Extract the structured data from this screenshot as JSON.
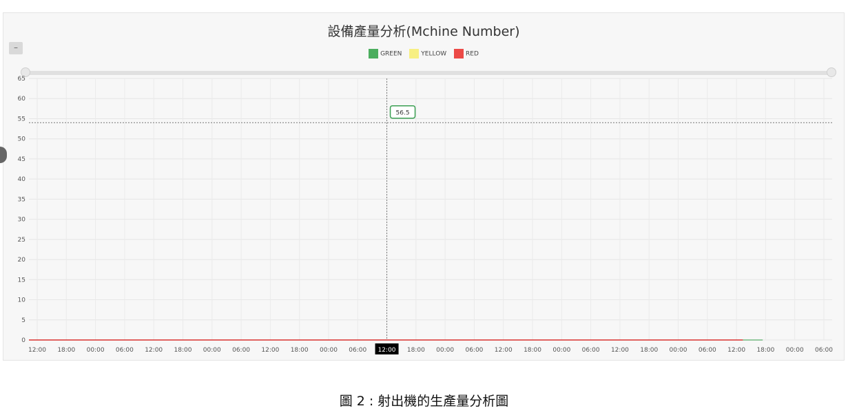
{
  "caption": "圖 2 : 射出機的生產量分析圖",
  "toolbar": {
    "zoom_out_label": "–"
  },
  "chart_data": {
    "type": "area",
    "stacked": true,
    "title": "設備產量分析(Mchine Number)",
    "xlabel": "",
    "ylabel": "",
    "ylim": [
      0,
      65
    ],
    "yticks": [
      0,
      5,
      10,
      15,
      20,
      25,
      30,
      35,
      40,
      45,
      50,
      55,
      60,
      65
    ],
    "x_tick_labels": [
      "12:00",
      "18:00",
      "00:00",
      "06:00",
      "12:00",
      "18:00",
      "00:00",
      "06:00",
      "12:00",
      "18:00",
      "00:00",
      "06:00",
      "12:00",
      "18:00",
      "00:00",
      "06:00",
      "12:00",
      "18:00",
      "00:00",
      "06:00",
      "12:00",
      "18:00",
      "00:00",
      "06:00",
      "12:00",
      "18:00",
      "00:00",
      "06:00"
    ],
    "x_highlight": "12:00",
    "grid": true,
    "legend_position": "top-center",
    "reference_line_y": 54,
    "tooltip_value": "56.5",
    "colors": {
      "GREEN": "#4cae5f",
      "YELLOW": "#f7ef83",
      "RED": "#ec4a47"
    },
    "x": [
      0,
      1,
      2,
      3,
      3.3,
      3.6,
      4,
      4.3,
      4.6,
      5,
      5.5,
      6,
      6.3,
      6.6,
      7,
      7.5,
      8,
      8.3,
      8.6,
      9,
      9.3,
      9.6,
      10,
      10.3,
      10.6,
      11,
      11.3,
      11.6,
      12,
      12.3,
      12.6,
      13,
      13.3,
      13.6,
      14,
      14.3,
      14.6,
      15,
      15.3,
      15.6,
      16,
      16.3,
      16.6,
      17,
      17.5,
      18,
      18.3,
      18.6,
      19,
      19.3,
      19.6,
      20,
      20.3,
      20.6,
      21,
      21.3,
      21.6,
      22,
      22.5,
      23,
      23.5,
      24,
      24.5,
      25,
      25.5,
      26,
      26.3,
      26.6,
      27,
      27.3,
      27.6,
      28,
      28.3,
      28.6,
      29,
      29.5,
      30,
      30.5,
      31,
      31.5,
      32,
      32.5,
      33,
      33.5,
      34,
      34.5,
      35,
      35.5,
      36,
      36.5,
      37,
      37.5,
      38,
      38.5,
      39,
      39.5,
      40,
      40.5,
      41,
      41.5,
      42,
      42.5,
      43,
      43.5,
      44,
      44.5,
      45,
      45.5,
      46,
      46.5,
      47,
      47.5,
      48,
      48.5,
      49,
      49.5,
      50,
      50.5,
      51,
      51.5,
      52,
      52.5,
      53,
      53.5,
      54,
      54.5,
      55,
      55.5,
      56,
      56.5,
      57,
      57.5,
      58,
      58.5,
      59,
      59.5,
      60,
      60.5,
      61,
      61.5,
      62,
      62.5,
      63,
      63.5,
      64,
      64.5,
      65,
      65.5,
      66,
      66.5,
      67,
      67.5,
      68,
      68.5,
      69,
      69.5,
      70,
      70.5,
      71,
      71.5,
      72,
      72.5,
      73,
      73.5,
      74,
      74.5,
      75,
      75.5,
      76,
      76.5,
      77,
      77.5,
      78,
      78.5,
      79,
      79.5,
      80,
      80.5,
      81,
      81.5,
      82,
      82.5,
      83,
      83.5,
      84,
      84.5,
      85,
      85.5,
      86,
      86.5,
      87,
      87.5,
      88,
      88.5,
      89,
      89.5,
      90,
      90.5,
      91,
      91.5,
      92,
      92.5,
      93,
      93.5,
      94,
      94.5,
      95,
      95.5,
      96,
      96.5,
      97,
      97.5,
      98,
      98.5,
      99,
      99.5,
      100,
      100.5,
      101,
      101.5,
      102,
      102.5,
      103,
      103.5,
      104,
      104.5,
      105,
      105.5,
      106,
      106.5,
      107,
      107.5,
      108,
      108.5,
      109,
      109.5,
      110,
      110.5,
      111,
      111.5,
      112,
      112.5,
      113,
      113.5,
      114,
      114.5,
      115,
      115.5,
      116,
      116.5,
      117,
      117.5,
      118,
      118.5,
      119,
      119.5,
      120,
      120.5,
      121,
      121.5,
      122,
      122.5,
      123,
      123.5,
      124,
      124.5,
      125,
      125.5,
      126,
      126.5,
      127,
      127.5,
      128,
      128.5,
      129,
      129.5,
      130,
      130.5,
      131,
      131.5,
      132,
      132.5,
      133,
      133.5,
      134,
      134.5,
      135,
      135.5,
      136,
      136.5,
      137,
      137.5,
      138,
      138.5,
      139,
      139.5,
      140,
      140.5,
      141,
      141.5,
      142,
      142.5,
      143,
      143.5,
      144,
      144.5,
      145,
      145.5,
      146,
      146.5,
      147,
      147.5,
      148,
      148.5,
      149,
      149.5,
      150,
      150.5,
      151,
      151.5,
      152,
      152.5,
      153,
      153.5,
      154,
      154.5,
      155,
      155.5,
      156,
      156.5,
      157,
      157.5,
      158,
      158.5,
      159,
      159.5,
      160,
      160.5,
      161,
      161.5,
      162
    ],
    "series": [
      {
        "name": "GREEN",
        "values": [
          0,
          0,
          0,
          0,
          0,
          0,
          0,
          0,
          0,
          0,
          0,
          0,
          0,
          0,
          0,
          0,
          0,
          0,
          0,
          0,
          0,
          0,
          0,
          0,
          0,
          0,
          0,
          0,
          0,
          0,
          0,
          0,
          0,
          0,
          0,
          0,
          0,
          0,
          0,
          0,
          0,
          0,
          0,
          0,
          0,
          0,
          0,
          0,
          0,
          0,
          0,
          0,
          0,
          0,
          0,
          0,
          0,
          0,
          0,
          0,
          0,
          0,
          0,
          0,
          0,
          0,
          0,
          0,
          0,
          0,
          0,
          0,
          0,
          0,
          0,
          0,
          0,
          0,
          0,
          0,
          0,
          0,
          0,
          0,
          0,
          0,
          0,
          0,
          0,
          0,
          0,
          0,
          0,
          0,
          0,
          0,
          0,
          0,
          0,
          0,
          0,
          0,
          0,
          0,
          0,
          0,
          0,
          0,
          0,
          0,
          0,
          0,
          0,
          0,
          0,
          0,
          0,
          0,
          0,
          0,
          0,
          0,
          0,
          0,
          0,
          0,
          0,
          0,
          0,
          0,
          0,
          0,
          0,
          0,
          0,
          0,
          0,
          0,
          0,
          0,
          0,
          0,
          0,
          0,
          0,
          0,
          0,
          0,
          0,
          0,
          0,
          0,
          0,
          0,
          0,
          0,
          0,
          0,
          0,
          0,
          0,
          0,
          0,
          0,
          0,
          0,
          0,
          0,
          0,
          0,
          0,
          0,
          0,
          0,
          0,
          0,
          0,
          0,
          0,
          0,
          0,
          0,
          0,
          0,
          0,
          0,
          0,
          0,
          0,
          0,
          0,
          0,
          0,
          0,
          0,
          0,
          0,
          0,
          0,
          0,
          0,
          0,
          0,
          0,
          0,
          0,
          0,
          0,
          0,
          0,
          0,
          0,
          0,
          0,
          0,
          0,
          0,
          0,
          0,
          0,
          0,
          0,
          0,
          0,
          0,
          0,
          0,
          0,
          0,
          0,
          0,
          0,
          0,
          0,
          0,
          0,
          0,
          0,
          0,
          0,
          0,
          0,
          0,
          0,
          0,
          0,
          0,
          0,
          0,
          0,
          0,
          0,
          0,
          0,
          0,
          0,
          0,
          0,
          0,
          0,
          0,
          0,
          0,
          0,
          0,
          0,
          0,
          0,
          0,
          0,
          0,
          0,
          0,
          0,
          0,
          0,
          0,
          0,
          0,
          0,
          0,
          0,
          0,
          0,
          0,
          0,
          0,
          0,
          0,
          0,
          0,
          0,
          0,
          0,
          0,
          0,
          0,
          0,
          0,
          0,
          0,
          0,
          0,
          0,
          0,
          0,
          0,
          0,
          0,
          0,
          0,
          0,
          0
        ]
      },
      {
        "name": "YELLOW",
        "values": [
          0,
          0,
          0,
          0,
          0,
          0,
          0,
          0,
          0,
          0,
          0,
          0,
          0,
          0,
          0,
          0,
          0,
          0,
          0,
          0,
          0,
          0,
          0,
          0,
          0,
          0,
          0,
          0,
          0,
          0,
          0,
          0,
          0,
          0,
          0,
          0,
          0,
          0,
          0,
          0,
          0,
          0,
          0,
          0,
          0,
          0,
          0,
          0,
          0,
          0,
          0,
          0,
          0,
          0,
          0,
          0,
          0,
          0,
          0,
          0,
          0,
          0,
          0,
          0,
          0,
          0,
          0,
          0,
          0,
          0,
          0,
          0,
          0,
          0,
          0,
          0,
          0,
          0,
          0,
          0,
          0,
          0,
          0,
          0,
          0,
          0,
          0,
          0,
          0,
          0,
          0,
          0,
          0,
          0,
          0,
          0,
          0,
          0,
          0,
          0,
          0,
          0,
          0,
          0,
          0,
          0,
          0,
          0,
          0,
          0,
          0,
          0,
          0,
          0,
          0,
          0,
          0,
          0,
          0,
          0,
          0,
          0,
          0,
          0,
          0,
          0,
          0,
          0,
          0,
          0,
          0,
          0,
          0,
          0,
          0,
          0,
          0,
          0,
          0,
          0,
          0,
          0,
          0,
          0,
          0,
          0,
          0,
          0,
          0,
          0,
          0,
          0,
          0,
          0,
          0,
          0,
          0,
          0,
          0,
          0,
          0,
          0,
          0,
          0,
          0,
          0,
          0,
          0,
          0,
          0,
          0,
          0,
          0,
          0,
          0,
          0,
          0,
          0,
          0,
          0,
          0,
          0,
          0,
          0,
          0,
          0,
          0,
          0,
          0,
          0,
          0,
          0,
          0,
          0,
          0,
          0,
          0,
          0,
          0,
          0,
          0,
          0,
          0,
          0,
          0,
          0,
          0,
          0,
          0,
          0,
          0,
          0,
          0,
          0,
          0,
          0,
          0,
          0,
          0,
          0,
          0,
          0,
          0,
          0,
          0,
          0,
          0,
          0,
          0,
          0,
          0,
          0,
          0,
          0,
          0,
          0,
          0,
          0,
          0,
          0,
          0,
          0,
          0,
          0,
          0,
          0,
          0,
          0,
          0,
          0,
          0,
          0,
          0,
          0,
          0,
          0,
          0,
          0,
          0,
          0,
          0,
          0,
          0,
          0,
          0,
          0,
          0,
          0,
          0,
          0,
          0,
          0,
          0,
          0,
          0,
          0,
          0,
          0,
          0,
          0,
          0,
          0,
          0,
          0,
          0,
          0,
          0,
          0,
          0,
          0,
          0,
          0,
          0,
          0,
          0,
          0,
          0,
          0,
          0,
          0,
          0,
          0,
          0,
          0,
          0
        ]
      },
      {
        "name": "RED",
        "values": [
          0,
          0,
          0,
          0,
          0,
          0,
          0,
          0,
          0,
          0,
          0,
          0,
          0,
          0,
          0,
          0,
          0,
          0,
          0,
          0,
          0,
          0,
          0,
          0,
          0,
          0,
          0,
          0,
          0,
          0,
          0,
          0,
          0,
          0,
          0,
          0,
          0,
          0,
          0,
          0,
          0,
          0,
          0,
          0,
          0,
          0,
          0,
          0,
          0,
          0,
          0,
          0,
          0,
          0,
          0,
          0,
          0,
          0,
          0,
          0,
          0,
          0,
          0,
          0,
          0,
          0,
          0,
          0,
          0,
          0,
          0,
          0,
          0,
          0,
          0,
          0,
          0,
          0,
          0,
          0,
          0,
          0,
          0,
          0,
          0,
          0,
          0,
          0,
          0,
          0,
          0,
          0,
          0,
          0,
          0,
          0,
          0,
          0,
          0,
          0,
          0,
          0,
          0,
          0,
          0,
          0,
          0,
          0,
          0,
          0,
          0,
          0,
          0,
          0,
          0,
          0,
          0,
          0,
          0,
          0,
          0,
          0,
          0,
          0,
          0,
          0,
          0,
          0,
          0,
          0,
          0,
          0,
          0,
          0,
          0,
          0,
          0,
          0,
          0,
          0,
          0,
          0,
          0,
          0,
          0,
          0,
          0,
          0,
          0,
          0,
          0,
          0,
          0,
          0,
          0,
          0,
          0,
          0,
          0,
          0,
          0,
          0,
          0,
          0,
          0,
          0,
          0,
          0,
          0,
          0,
          0,
          0,
          0,
          0,
          0,
          0,
          0,
          0,
          0,
          0,
          0,
          0,
          0,
          0,
          0,
          0,
          0,
          0,
          0,
          0,
          0,
          0,
          0,
          0,
          0,
          0,
          0,
          0,
          0,
          0,
          0,
          0,
          0,
          0,
          0,
          0,
          0,
          0,
          0,
          0,
          0,
          0,
          0,
          0,
          0,
          0,
          0,
          0,
          0,
          0,
          0,
          0,
          0,
          0,
          0,
          0,
          0,
          0,
          0,
          0,
          0,
          0,
          0,
          0,
          0,
          0,
          0,
          0,
          0,
          0,
          0,
          0,
          0,
          0,
          0,
          0,
          0,
          0,
          0,
          0,
          0,
          0,
          0,
          0,
          0,
          0,
          0,
          0,
          0,
          0,
          0,
          0,
          0,
          0,
          0,
          0,
          0,
          0,
          0,
          0,
          0,
          0,
          0,
          0,
          0,
          0,
          0,
          0,
          0,
          0,
          0,
          0,
          0,
          0,
          0,
          0,
          0,
          0,
          0,
          0,
          0,
          0,
          0,
          0,
          0,
          0,
          0,
          0,
          0,
          0,
          0,
          0,
          0,
          0,
          0,
          0,
          0,
          0,
          0
        ]
      }
    ]
  }
}
